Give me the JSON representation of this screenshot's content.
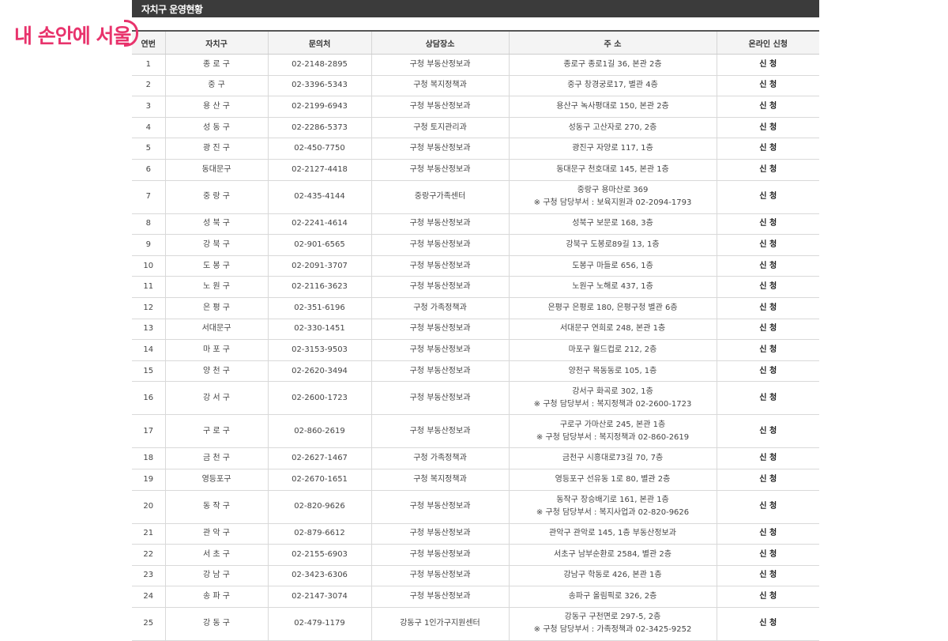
{
  "logo": {
    "text": "내 손안에 서울"
  },
  "section": {
    "title": "자치구 운영현황"
  },
  "table": {
    "headers": [
      "연번",
      "자치구",
      "문의처",
      "상담장소",
      "주 소",
      "온라인 신청"
    ],
    "rows": [
      {
        "no": "1",
        "district": "종 로 구",
        "phone": "02-2148-2895",
        "place": "구청 부동산정보과",
        "address": [
          "종로구 종로1길 36, 본관 2층"
        ],
        "apply": "신 청"
      },
      {
        "no": "2",
        "district": "중 구",
        "phone": "02-3396-5343",
        "place": "구청 복지정책과",
        "address": [
          "중구 창경궁로17, 별관 4층"
        ],
        "apply": "신 청"
      },
      {
        "no": "3",
        "district": "용 산 구",
        "phone": "02-2199-6943",
        "place": "구청 부동산정보과",
        "address": [
          "용산구 녹사평대로 150, 본관 2층"
        ],
        "apply": "신 청"
      },
      {
        "no": "4",
        "district": "성 동 구",
        "phone": "02-2286-5373",
        "place": "구청 토지관리과",
        "address": [
          "성동구 고산자로 270, 2층"
        ],
        "apply": "신 청"
      },
      {
        "no": "5",
        "district": "광 진 구",
        "phone": "02-450-7750",
        "place": "구청 부동산정보과",
        "address": [
          "광진구 자양로 117, 1층"
        ],
        "apply": "신 청"
      },
      {
        "no": "6",
        "district": "동대문구",
        "phone": "02-2127-4418",
        "place": "구청 부동산정보과",
        "address": [
          "동대문구 천호대로 145, 본관 1층"
        ],
        "apply": "신 청"
      },
      {
        "no": "7",
        "district": "중 랑 구",
        "phone": "02-435-4144",
        "place": "중랑구가족센터",
        "address": [
          "중랑구 용마산로 369",
          "※ 구청 담당부서 : 보육지원과 02-2094-1793"
        ],
        "apply": "신 청"
      },
      {
        "no": "8",
        "district": "성 북 구",
        "phone": "02-2241-4614",
        "place": "구청 부동산정보과",
        "address": [
          "성북구 보문로 168, 3층"
        ],
        "apply": "신 청"
      },
      {
        "no": "9",
        "district": "강 북 구",
        "phone": "02-901-6565",
        "place": "구청 부동산정보과",
        "address": [
          "강북구 도봉로89길 13, 1층"
        ],
        "apply": "신 청"
      },
      {
        "no": "10",
        "district": "도 봉 구",
        "phone": "02-2091-3707",
        "place": "구청 부동산정보과",
        "address": [
          "도봉구 마들로 656, 1층"
        ],
        "apply": "신 청"
      },
      {
        "no": "11",
        "district": "노 원 구",
        "phone": "02-2116-3623",
        "place": "구청 부동산정보과",
        "address": [
          "노원구 노해로 437, 1층"
        ],
        "apply": "신 청"
      },
      {
        "no": "12",
        "district": "은 평 구",
        "phone": "02-351-6196",
        "place": "구청 가족정책과",
        "address": [
          "은평구 은평로 180, 은평구청 별관 6층"
        ],
        "apply": "신 청"
      },
      {
        "no": "13",
        "district": "서대문구",
        "phone": "02-330-1451",
        "place": "구청 부동산정보과",
        "address": [
          "서대문구 연희로 248, 본관 1층"
        ],
        "apply": "신 청"
      },
      {
        "no": "14",
        "district": "마 포 구",
        "phone": "02-3153-9503",
        "place": "구청 부동산정보과",
        "address": [
          "마포구 월드컵로 212, 2층"
        ],
        "apply": "신 청"
      },
      {
        "no": "15",
        "district": "양 천 구",
        "phone": "02-2620-3494",
        "place": "구청 부동산정보과",
        "address": [
          "양천구 목동동로 105, 1층"
        ],
        "apply": "신 청"
      },
      {
        "no": "16",
        "district": "강 서 구",
        "phone": "02-2600-1723",
        "place": "구청 부동산정보과",
        "address": [
          "강서구 화곡로 302, 1층",
          "※ 구청 담당부서 : 복지정책과 02-2600-1723"
        ],
        "apply": "신 청"
      },
      {
        "no": "17",
        "district": "구 로 구",
        "phone": "02-860-2619",
        "place": "구청 부동산정보과",
        "address": [
          "구로구 가마산로 245, 본관 1층",
          "※ 구청 담당부서 : 복지정책과 02-860-2619"
        ],
        "apply": "신 청"
      },
      {
        "no": "18",
        "district": "금 천 구",
        "phone": "02-2627-1467",
        "place": "구청 가족정책과",
        "address": [
          "금천구 시흥대로73길 70, 7층"
        ],
        "apply": "신 청"
      },
      {
        "no": "19",
        "district": "영등포구",
        "phone": "02-2670-1651",
        "place": "구청 복지정책과",
        "address": [
          "영등포구 선유동 1로 80, 별관 2층"
        ],
        "apply": "신 청"
      },
      {
        "no": "20",
        "district": "동 작 구",
        "phone": "02-820-9626",
        "place": "구청 부동산정보과",
        "address": [
          "동작구 장승배기로 161, 본관 1층",
          "※ 구청 담당부서 : 복지사업과 02-820-9626"
        ],
        "apply": "신 청"
      },
      {
        "no": "21",
        "district": "관 악 구",
        "phone": "02-879-6612",
        "place": "구청 부동산정보과",
        "address": [
          "관악구 관악로 145, 1층 부동산정보과"
        ],
        "apply": "신 청"
      },
      {
        "no": "22",
        "district": "서 초 구",
        "phone": "02-2155-6903",
        "place": "구청 부동산정보과",
        "address": [
          "서초구 남부순환로 2584, 별관 2층"
        ],
        "apply": "신 청"
      },
      {
        "no": "23",
        "district": "강 남 구",
        "phone": "02-3423-6306",
        "place": "구청 부동산정보과",
        "address": [
          "강남구 학동로 426, 본관 1층"
        ],
        "apply": "신 청"
      },
      {
        "no": "24",
        "district": "송 파 구",
        "phone": "02-2147-3074",
        "place": "구청 부동산정보과",
        "address": [
          "송파구 올림픽로 326, 2층"
        ],
        "apply": "신 청"
      },
      {
        "no": "25",
        "district": "강 동 구",
        "phone": "02-479-1179",
        "place": "강동구 1인가구지원센터",
        "address": [
          "강동구 구천면로 297-5, 2층",
          "※ 구청 담당부서 : 가족정책과 02-3425-9252"
        ],
        "apply": "신 청"
      }
    ]
  }
}
